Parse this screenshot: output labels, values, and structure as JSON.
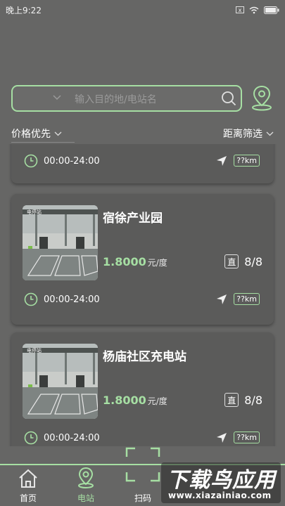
{
  "status_bar": {
    "time": "晚上9:22",
    "sim_badge": "x"
  },
  "search": {
    "placeholder": "输入目的地/电站名"
  },
  "filters": {
    "price_sort": "价格优先",
    "distance_filter": "距离筛选"
  },
  "stations": [
    {
      "name": "",
      "hours": "00:00-24:00",
      "distance": "??km"
    },
    {
      "name": "宿徐产业园",
      "price": "1.8000",
      "unit": "元/度",
      "dc": "直",
      "count": "8/8",
      "hours": "00:00-24:00",
      "distance": "??km",
      "thumb_sign": "电停站"
    },
    {
      "name": "杨庙社区充电站",
      "price": "1.8000",
      "unit": "元/度",
      "dc": "直",
      "count": "8/8",
      "hours": "00:00-24:00",
      "distance": "??km",
      "thumb_sign": "电停站"
    }
  ],
  "tabs": [
    {
      "label": "首页",
      "icon": "home-icon"
    },
    {
      "label": "电站",
      "icon": "location-pin-icon"
    },
    {
      "label": "扫码",
      "icon": "scan-icon"
    }
  ],
  "watermark": {
    "title": "下载鸟应用",
    "url": "www.xiazainiao.com"
  },
  "colors": {
    "accent": "#a6dfa3",
    "background": "#666665",
    "card": "#5b5b5a"
  }
}
